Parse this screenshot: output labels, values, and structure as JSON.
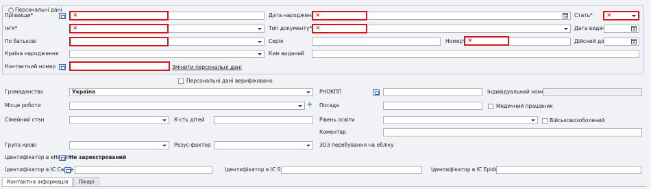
{
  "group": {
    "title": "Персональні дані",
    "collapse_glyph": "⌃"
  },
  "personal": {
    "surname": {
      "label": "Прізвище*",
      "value": "✕"
    },
    "name": {
      "label": "Ім'я*",
      "value": "✕"
    },
    "patronymic": {
      "label": "По батькові",
      "value": ""
    },
    "birth_country": {
      "label": "Країна народження",
      "value": ""
    },
    "contact_phone": {
      "label": "Контактний номер",
      "value": ""
    },
    "birth_date": {
      "label": "Дата народження*",
      "value": "✕"
    },
    "doc_type": {
      "label": "Тип документу*",
      "value": "✕"
    },
    "series": {
      "label": "Серія",
      "value": ""
    },
    "issued_by": {
      "label": "Ким виданий",
      "value": ""
    },
    "number": {
      "label": "Номер*",
      "value": "✕"
    },
    "sex": {
      "label": "Стать*",
      "value": "✕"
    },
    "issue_date": {
      "label": "Дата видачі",
      "value": ""
    },
    "valid_until": {
      "label": "Дійсний до",
      "value": ""
    },
    "change_link": "Змінити персональні дані",
    "verified_label": "Персональні дані верифіковано"
  },
  "other": {
    "citizenship": {
      "label": "Громадянство",
      "value": "Україна"
    },
    "workplace": {
      "label": "Місце роботи",
      "value": ""
    },
    "marital": {
      "label": "Сімейний стан",
      "value": ""
    },
    "children": {
      "label": "К-сть дітей",
      "value": ""
    },
    "blood_group": {
      "label": "Група крові",
      "value": ""
    },
    "rh": {
      "label": "Резус-фактор",
      "value": ""
    },
    "rnokpp": {
      "label": "РНОКПП",
      "value": ""
    },
    "position": {
      "label": "Посада",
      "value": ""
    },
    "education": {
      "label": "Рівень освіти",
      "value": ""
    },
    "comment": {
      "label": "Коментар",
      "value": ""
    },
    "zoz": {
      "label": "ЗОЗ перебування на обліку",
      "value": ""
    },
    "individual_number": {
      "label": "Індивідуальний номер",
      "value": ""
    },
    "medical_worker": "Медичний працівник",
    "military": "Військовозоболений",
    "ehealth": {
      "label": "Ідентифікатор в eHealth",
      "status": "Не зареєстрований"
    },
    "ic_case": {
      "label": "Ідентифікатор в IC Case++",
      "value": ""
    },
    "ic_syrex": {
      "label": "Ідентифікатор в IC Syrex",
      "value": ""
    },
    "ic_epidaids": {
      "label": "Ідентифікатор в IC EpidAIDS",
      "value": ""
    }
  },
  "tabs": [
    "Контактна інформація",
    "Лікарі"
  ],
  "colors": {
    "required_border": "#d2141b",
    "accent": "#3f6fb5"
  }
}
